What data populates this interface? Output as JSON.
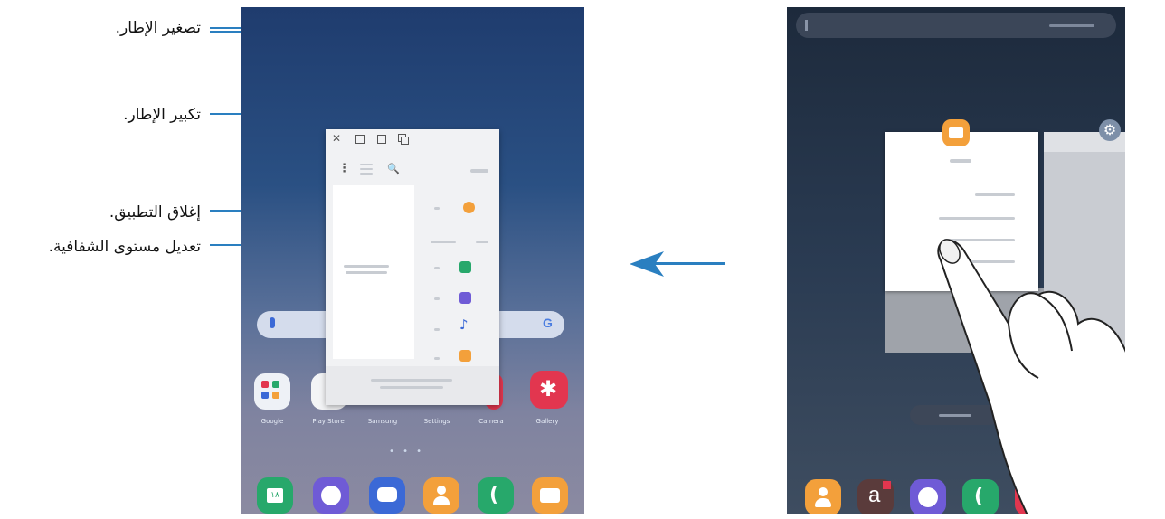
{
  "callouts": {
    "minimize": "تصغير الإطار.",
    "maximize": "تكبير الإطار.",
    "close": "إغلاق التطبيق.",
    "opacity": "تعديل مستوى الشفافية."
  },
  "popup_window": {
    "close_glyph": "✕",
    "more_glyph": "⋮",
    "search_glyph": "🔍"
  },
  "left_tablet": {
    "pager": "• • •",
    "google_label": "G",
    "apps": [
      "Google",
      "Play Store",
      "Samsung",
      "Settings",
      "Camera",
      "Gallery"
    ],
    "dock_badge": "١٨"
  },
  "right_tablet": {
    "gear_glyph": "⚙"
  },
  "colors": {
    "leader": "#2a7fc0",
    "arrow": "#2a7fc0",
    "orange": "#f3a03b",
    "green": "#27a86b",
    "red": "#e2364f",
    "purple": "#6f5bd6",
    "blue": "#3b69d6"
  }
}
